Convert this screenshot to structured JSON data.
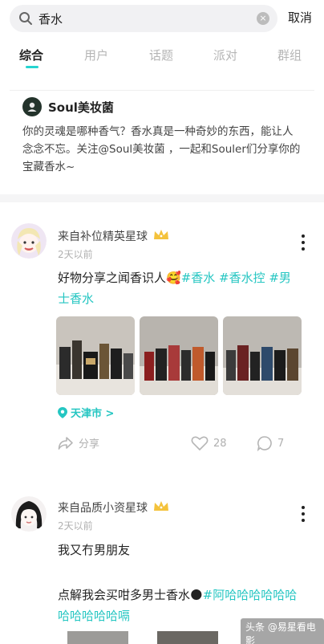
{
  "search": {
    "query": "香水",
    "cancel_label": "取消"
  },
  "tabs": [
    {
      "label": "综合",
      "active": true
    },
    {
      "label": "用户",
      "active": false
    },
    {
      "label": "话题",
      "active": false
    },
    {
      "label": "派对",
      "active": false
    },
    {
      "label": "群组",
      "active": false
    }
  ],
  "account": {
    "name": "Soul美妆菌",
    "description": "你的灵魂是哪种香气？香水真是一种奇妙的东西，能让人念念不忘。关注@Soul美妆菌 ，一起和Souler们分享你的宝藏香水~"
  },
  "posts": [
    {
      "origin": "来自补位精英星球",
      "time": "2天以前",
      "text": "好物分享之闻香识人🥰",
      "tags": "#香水 #香水控 #男士香水",
      "location": "天津市 >",
      "share_label": "分享",
      "like_count": "28",
      "comment_count": "7"
    },
    {
      "origin": "来自品质小资星球",
      "time": "2天以前",
      "text": "我又冇男朋友",
      "text2": "点解我会买咁多男士香水🌑",
      "tags": "#阿哈哈哈哈哈哈哈哈哈哈哈嗝"
    }
  ],
  "watermark": "头条 @易星看电影",
  "colors": {
    "accent": "#25c6c2",
    "crown": "#f4c23b"
  }
}
